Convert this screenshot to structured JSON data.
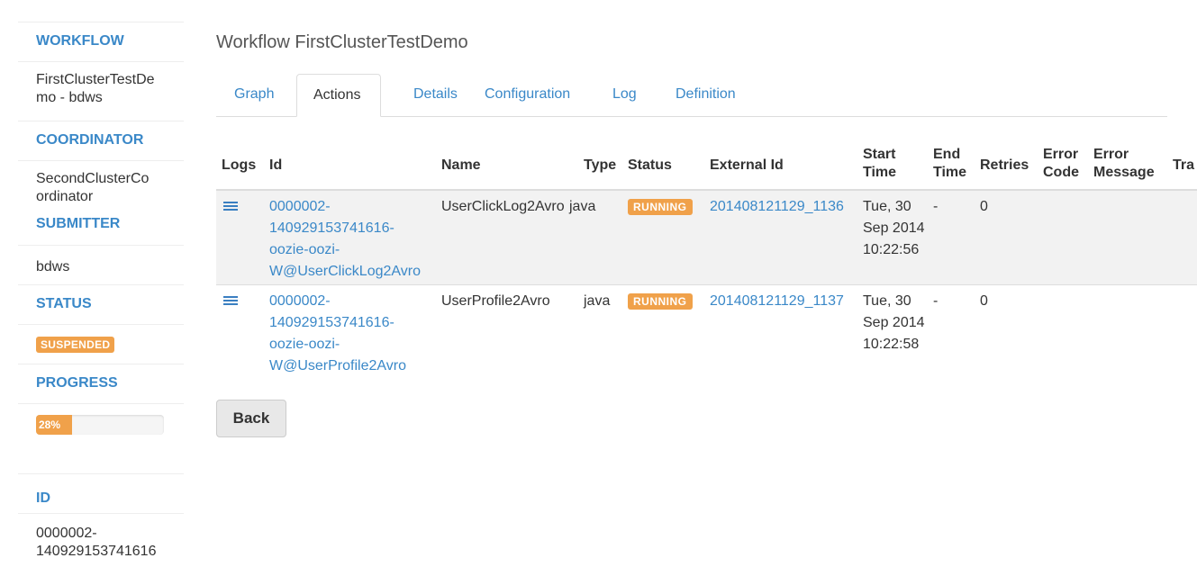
{
  "sidebar": {
    "workflow_heading": "WORKFLOW",
    "workflow_value": "FirstClusterTestDe mo - bdws",
    "coordinator_heading": "COORDINATOR",
    "coordinator_value": "SecondClusterCo ordinator",
    "submitter_heading": "SUBMITTER",
    "submitter_value": "bdws",
    "status_heading": "STATUS",
    "status_value": "SUSPENDED",
    "progress_heading": "PROGRESS",
    "progress_label": "28%",
    "progress_fraction": 0.28,
    "id_heading": "ID",
    "id_value": "0000002- 140929153741616"
  },
  "main": {
    "title": "Workflow FirstClusterTestDemo",
    "tabs": [
      {
        "label": "Graph"
      },
      {
        "label": "Actions"
      },
      {
        "label": "Details"
      },
      {
        "label": "Configuration"
      },
      {
        "label": "Log"
      },
      {
        "label": "Definition"
      }
    ],
    "active_tab": "Actions",
    "back_label": "Back"
  },
  "actions_table": {
    "columns": [
      "Logs",
      "Id",
      "Name",
      "Type",
      "Status",
      "External Id",
      "Start Time",
      "End Time",
      "Retries",
      "Error Code",
      "Error Message",
      "Tra"
    ],
    "rows": [
      {
        "id": "0000002- 140929153741616- oozie-oozi- W@UserClickLog2Avro",
        "name": "UserClickLog2Avro",
        "type": "java",
        "status": "RUNNING",
        "external_id": "201408121129_1136",
        "start_time": "Tue, 30 Sep 2014 10:22:56",
        "end_time": "-",
        "retries": "0",
        "error_code": "",
        "error_message": ""
      },
      {
        "id": "0000002- 140929153741616- oozie-oozi- W@UserProfile2Avro",
        "name": "UserProfile2Avro",
        "type": "java",
        "status": "RUNNING",
        "external_id": "201408121129_1137",
        "start_time": "Tue, 30 Sep 2014 10:22:58",
        "end_time": "-",
        "retries": "0",
        "error_code": "",
        "error_message": ""
      }
    ]
  },
  "colors": {
    "link": "#3a88c8",
    "badge_orange": "#f0a14a",
    "stripe": "#f2f2f2"
  }
}
